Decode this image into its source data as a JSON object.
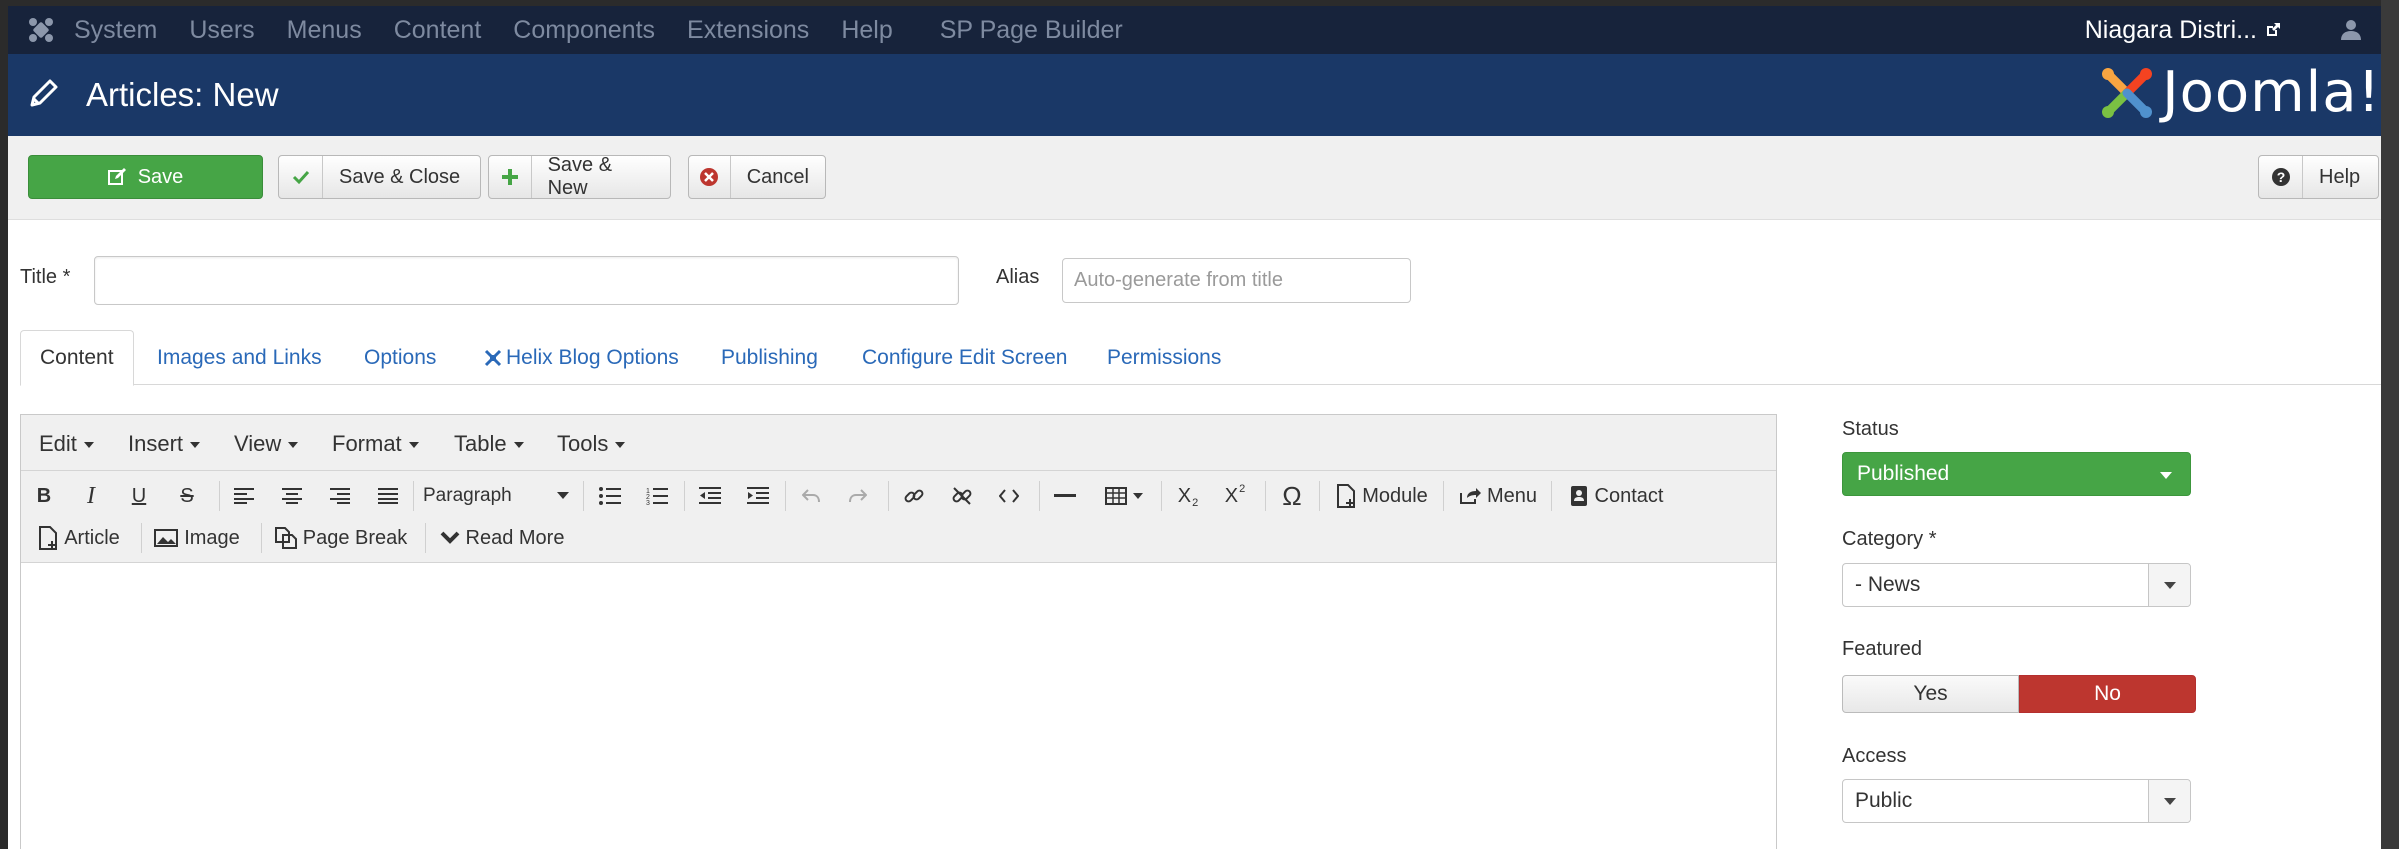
{
  "topnav": {
    "items": [
      "System",
      "Users",
      "Menus",
      "Content",
      "Components",
      "Extensions",
      "Help",
      "SP Page Builder"
    ],
    "site_link": "Niagara Distri...",
    "bg": "#17233b"
  },
  "header": {
    "title": "Articles: New",
    "brand": "Joomla!",
    "bg": "#1a3867"
  },
  "toolbar": {
    "save": "Save",
    "save_close": "Save & Close",
    "save_new": "Save & New",
    "cancel": "Cancel",
    "help": "Help",
    "save_color": "#46a546"
  },
  "form": {
    "title_label": "Title *",
    "title_value": "",
    "alias_label": "Alias",
    "alias_placeholder": "Auto-generate from title"
  },
  "tabs": [
    "Content",
    "Images and Links",
    "Options",
    "Helix Blog Options",
    "Publishing",
    "Configure Edit Screen",
    "Permissions"
  ],
  "editor": {
    "menus": [
      "Edit",
      "Insert",
      "View",
      "Format",
      "Table",
      "Tools"
    ],
    "format_select": "Paragraph",
    "buttons": {
      "module": "Module",
      "menu": "Menu",
      "contact": "Contact",
      "article": "Article",
      "image": "Image",
      "page_break": "Page Break",
      "read_more": "Read More"
    }
  },
  "sidebar": {
    "status_label": "Status",
    "status_value": "Published",
    "category_label": "Category *",
    "category_value": "- News",
    "featured_label": "Featured",
    "featured_yes": "Yes",
    "featured_no": "No",
    "access_label": "Access",
    "access_value": "Public",
    "published_color": "#46a546",
    "no_color": "#bd362f"
  }
}
